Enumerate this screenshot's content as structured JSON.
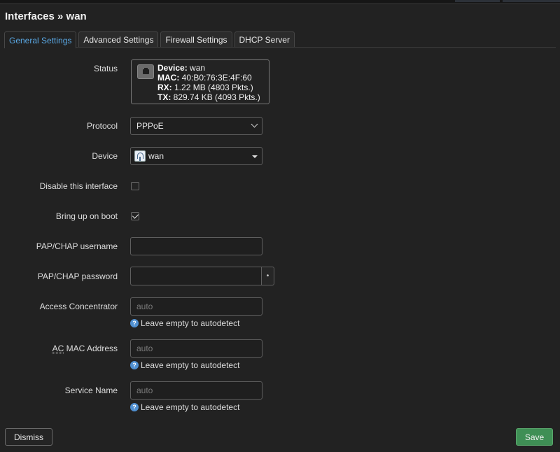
{
  "title": "Interfaces » wan",
  "tabs": [
    {
      "label": "General Settings"
    },
    {
      "label": "Advanced Settings"
    },
    {
      "label": "Firewall Settings"
    },
    {
      "label": "DHCP Server"
    }
  ],
  "status": {
    "label": "Status",
    "device_key": "Device:",
    "device_val": " wan",
    "mac_key": "MAC:",
    "mac_val": " 40:B0:76:3E:4F:60",
    "rx_key": "RX:",
    "rx_val": " 1.22 MB (4803 Pkts.)",
    "tx_key": "TX:",
    "tx_val": " 829.74 KB (4093 Pkts.)"
  },
  "protocol": {
    "label": "Protocol",
    "value": "PPPoE"
  },
  "device": {
    "label": "Device",
    "value": "wan"
  },
  "disable": {
    "label": "Disable this interface",
    "checked": false
  },
  "boot": {
    "label": "Bring up on boot",
    "checked": true
  },
  "username": {
    "label": "PAP/CHAP username",
    "value": ""
  },
  "password": {
    "label": "PAP/CHAP password",
    "value": "",
    "reveal": "•"
  },
  "access_concentrator": {
    "label": "Access Concentrator",
    "placeholder": "auto",
    "hint": "Leave empty to autodetect"
  },
  "ac_mac": {
    "label_abbr": "AC",
    "label_rest": " MAC Address",
    "placeholder": "auto",
    "hint": "Leave empty to autodetect"
  },
  "service_name": {
    "label": "Service Name",
    "placeholder": "auto",
    "hint": "Leave empty to autodetect"
  },
  "hint_icon": "?",
  "buttons": {
    "dismiss": "Dismiss",
    "save": "Save"
  },
  "colors": {
    "accent": "#5aa9e6",
    "save": "#3f8f55",
    "background": "#222222"
  }
}
